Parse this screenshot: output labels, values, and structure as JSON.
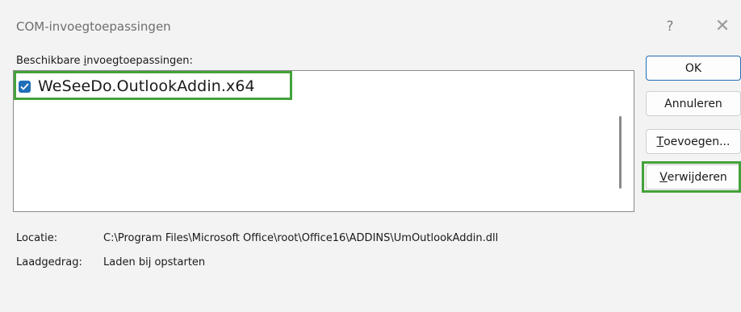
{
  "window": {
    "title": "COM-invoegtoepassingen",
    "help_glyph": "?",
    "close_glyph": "✕"
  },
  "list": {
    "label_pre": "Beschikbare ",
    "label_mnemonic": "i",
    "label_post": "nvoegtoepassingen:",
    "items": [
      {
        "label": "WeSeeDo.OutlookAddin.x64",
        "checked": true
      }
    ]
  },
  "buttons": {
    "ok": "OK",
    "cancel": "Annuleren",
    "add_mnemonic": "T",
    "add_rest": "oevoegen...",
    "remove_mnemonic": "V",
    "remove_rest": "erwijderen"
  },
  "info": {
    "location_label": "Locatie:",
    "location_value": "C:\\Program Files\\Microsoft Office\\root\\Office16\\ADDINS\\UmOutlookAddin.dll",
    "load_label": "Laadgedrag:",
    "load_value": "Laden bij opstarten"
  },
  "colors": {
    "highlight": "#43a23a",
    "accent": "#1f6fb8"
  }
}
